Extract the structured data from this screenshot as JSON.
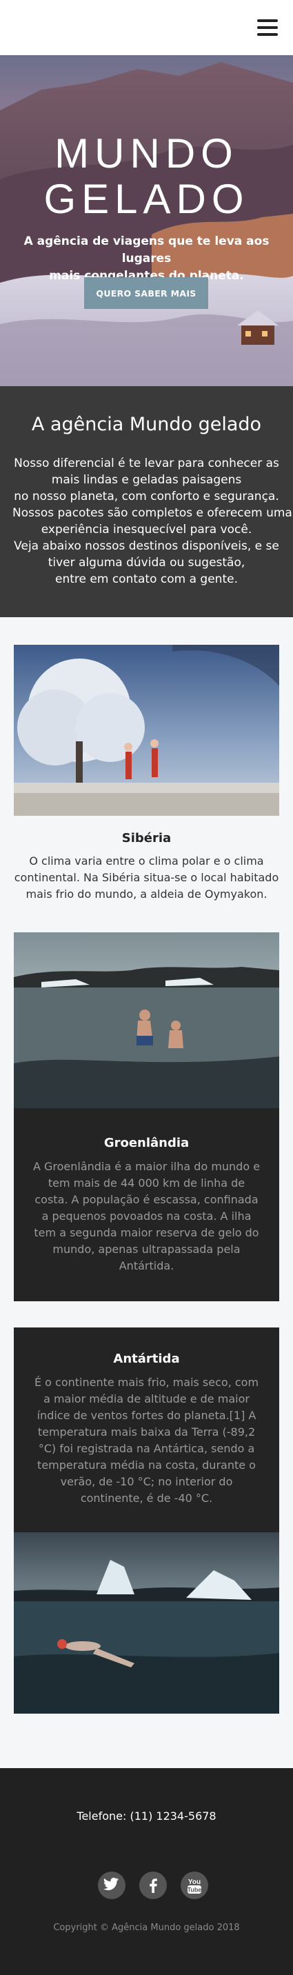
{
  "header": {
    "menu_icon": "hamburger-menu-icon"
  },
  "hero": {
    "title_line1": "MUNDO",
    "title_line2": "GELADO",
    "subtitle_line1": "A agência de viagens que te leva aos lugares",
    "subtitle_line2": "mais congelantes do planeta.",
    "button_label": "QUERO SABER MAIS"
  },
  "about": {
    "title": "A agência Mundo gelado",
    "lines": [
      "Nosso diferencial é te levar para conhecer as",
      "mais lindas e geladas paisagens",
      "no nosso planeta, com conforto e segurança.",
      "Nossos pacotes são completos e oferecem uma",
      "experiência inesquecível para você.",
      "Veja abaixo nossos destinos disponíveis, e se",
      "tiver alguma dúvida ou sugestão,",
      "entre em contato com a gente."
    ]
  },
  "destinations": {
    "siberia": {
      "title": "Sibéria",
      "lines": [
        "O clima varia entre o clima polar e o clima",
        "continental. Na Sibéria situa-se o local habitado",
        "mais frio do mundo, a aldeia de Oymyakon."
      ]
    },
    "groenlandia": {
      "title": "Groenlândia",
      "lines": [
        "A Groenlândia é a maior ilha do mundo e",
        "tem mais de 44 000 km de linha de",
        "costa. A população é escassa, confinada",
        "a pequenos povoados na costa. A ilha",
        "tem a segunda maior reserva de gelo do",
        "mundo, apenas ultrapassada pela",
        "Antártida."
      ]
    },
    "antartida": {
      "title": "Antártida",
      "lines": [
        "É o continente mais frio, mais seco, com",
        "a maior média de altitude e de maior",
        "índice de ventos fortes do planeta.[1] A",
        "temperatura mais baixa da Terra (-89,2",
        "°C) foi registrada na Antártica, sendo a",
        "temperatura média na costa, durante o",
        "verão, de -10 °C; no interior do",
        "continente, é de -40 °C."
      ]
    }
  },
  "footer": {
    "phone": "Telefone: (11) 1234-5678",
    "social": [
      "twitter-icon",
      "facebook-icon",
      "youtube-icon"
    ],
    "youtube_you": "You",
    "youtube_tube": "Tube",
    "copyright": "Copyright © Agência Mundo gelado 2018"
  },
  "colors": {
    "button": "#7896a4",
    "about_bg": "#3a3a3a",
    "dark_card_bg": "#242424",
    "footer_bg": "#212121"
  }
}
